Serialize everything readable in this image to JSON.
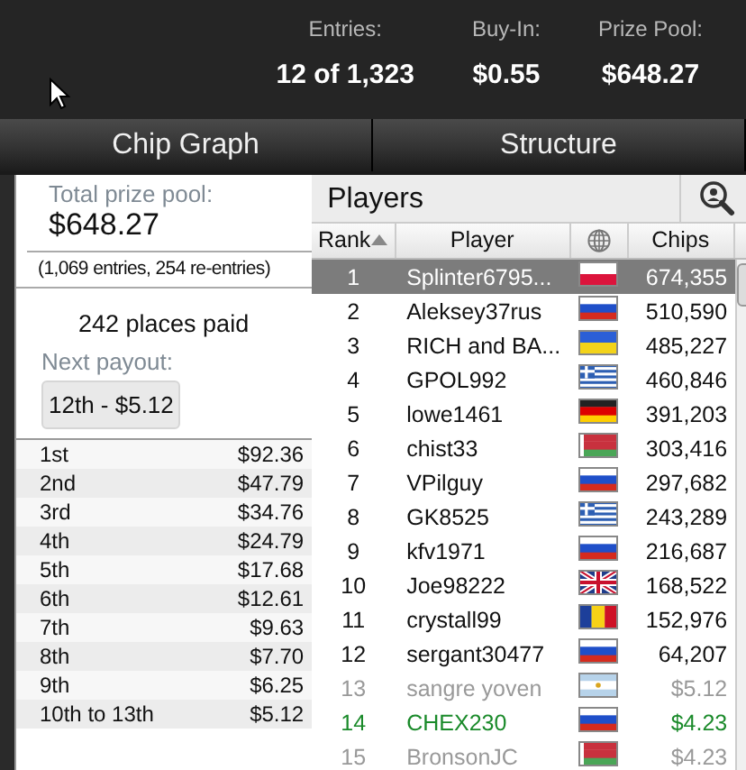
{
  "header": {
    "stats": [
      {
        "label": "Entries:",
        "value": "12 of 1,323"
      },
      {
        "label": "Buy-In:",
        "value": "$0.55"
      },
      {
        "label": "Prize Pool:",
        "value": "$648.27"
      }
    ]
  },
  "tabs": [
    {
      "label": "Chip Graph",
      "selected": false
    },
    {
      "label": "Structure",
      "selected": false
    }
  ],
  "prize_panel": {
    "total_label": "Total prize pool:",
    "total_value": "$648.27",
    "entries_note": "(1,069 entries, 254 re-entries)",
    "places_paid": "242 places paid",
    "next_payout_label": "Next payout:",
    "next_payout": "12th - $5.12",
    "payouts": [
      {
        "place": "1st",
        "amount": "$92.36"
      },
      {
        "place": "2nd",
        "amount": "$47.79"
      },
      {
        "place": "3rd",
        "amount": "$34.76"
      },
      {
        "place": "4th",
        "amount": "$24.79"
      },
      {
        "place": "5th",
        "amount": "$17.68"
      },
      {
        "place": "6th",
        "amount": "$12.61"
      },
      {
        "place": "7th",
        "amount": "$9.63"
      },
      {
        "place": "8th",
        "amount": "$7.70"
      },
      {
        "place": "9th",
        "amount": "$6.25"
      },
      {
        "place": "10th to 13th",
        "amount": "$5.12"
      }
    ]
  },
  "players": {
    "title": "Players",
    "columns": [
      "Rank",
      "Player",
      "Chips"
    ],
    "rows": [
      {
        "rank": "1",
        "name": "Splinter6795...",
        "flag": {
          "kind": "pl"
        },
        "chips": "674,355",
        "kind": "active",
        "selected": true
      },
      {
        "rank": "2",
        "name": "Aleksey37rus",
        "flag": {
          "kind": "ru"
        },
        "chips": "510,590",
        "kind": "active",
        "selected": false
      },
      {
        "rank": "3",
        "name": "RICH and BA...",
        "flag": {
          "kind": "ua"
        },
        "chips": "485,227",
        "kind": "active",
        "selected": false
      },
      {
        "rank": "4",
        "name": "GPOL992",
        "flag": {
          "kind": "gr"
        },
        "chips": "460,846",
        "kind": "active",
        "selected": false
      },
      {
        "rank": "5",
        "name": "lowe1461",
        "flag": {
          "kind": "de"
        },
        "chips": "391,203",
        "kind": "active",
        "selected": false
      },
      {
        "rank": "6",
        "name": "chist33",
        "flag": {
          "kind": "by"
        },
        "chips": "303,416",
        "kind": "active",
        "selected": false
      },
      {
        "rank": "7",
        "name": "VPilguy",
        "flag": {
          "kind": "ru"
        },
        "chips": "297,682",
        "kind": "active",
        "selected": false
      },
      {
        "rank": "8",
        "name": "GK8525",
        "flag": {
          "kind": "gr"
        },
        "chips": "243,289",
        "kind": "active",
        "selected": false
      },
      {
        "rank": "9",
        "name": "kfv1971",
        "flag": {
          "kind": "ru"
        },
        "chips": "216,687",
        "kind": "active",
        "selected": false
      },
      {
        "rank": "10",
        "name": "Joe98222",
        "flag": {
          "kind": "gb"
        },
        "chips": "168,522",
        "kind": "active",
        "selected": false
      },
      {
        "rank": "11",
        "name": "crystall99",
        "flag": {
          "kind": "ro"
        },
        "chips": "152,976",
        "kind": "active",
        "selected": false
      },
      {
        "rank": "12",
        "name": "sergant30477",
        "flag": {
          "kind": "ru"
        },
        "chips": "64,207",
        "kind": "active",
        "selected": false
      },
      {
        "rank": "13",
        "name": "sangre yoven",
        "flag": {
          "kind": "ar"
        },
        "chips": "$5.12",
        "kind": "out",
        "selected": false
      },
      {
        "rank": "14",
        "name": "CHEX230",
        "flag": {
          "kind": "ru"
        },
        "chips": "$4.23",
        "kind": "paid",
        "selected": false
      },
      {
        "rank": "15",
        "name": "BronsonJC",
        "flag": {
          "kind": "by"
        },
        "chips": "$4.23",
        "kind": "out",
        "selected": false
      }
    ]
  }
}
